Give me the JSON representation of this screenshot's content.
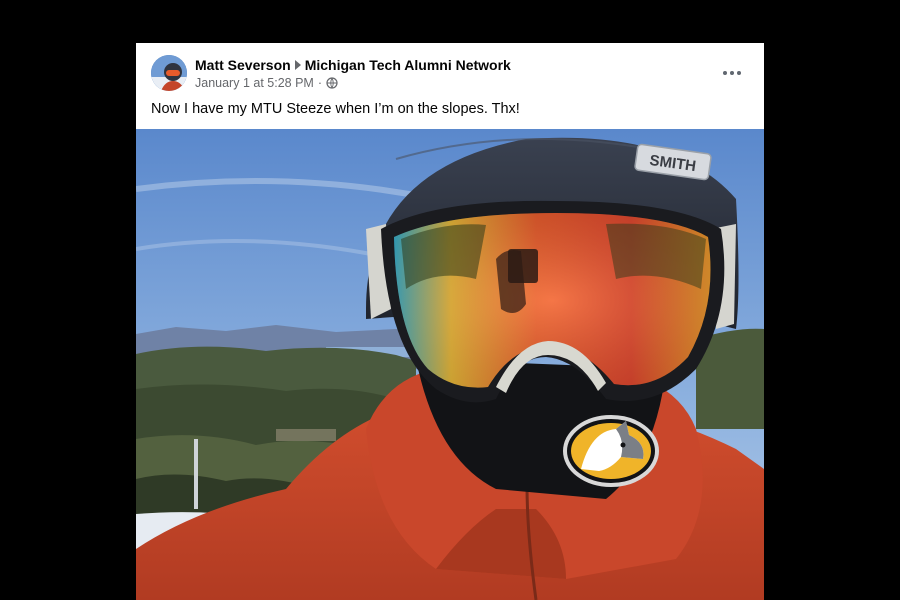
{
  "post": {
    "author": "Matt Severson",
    "group": "Michigan Tech Alumni Network",
    "timestamp": "January 1 at 5:28 PM",
    "separator": "·",
    "privacy_icon": "globe-icon",
    "more_icon": "more-options-icon",
    "text": "Now I have my MTU Steeze when I’m on the slopes.  Thx!",
    "helmet_brand": "SMITH"
  },
  "colors": {
    "background": "#000000",
    "card": "#ffffff",
    "text_primary": "#050505",
    "text_secondary": "#65676b",
    "jacket": "#c4452a",
    "helmet": "#2f3440",
    "sky": "#5f8fd0"
  }
}
